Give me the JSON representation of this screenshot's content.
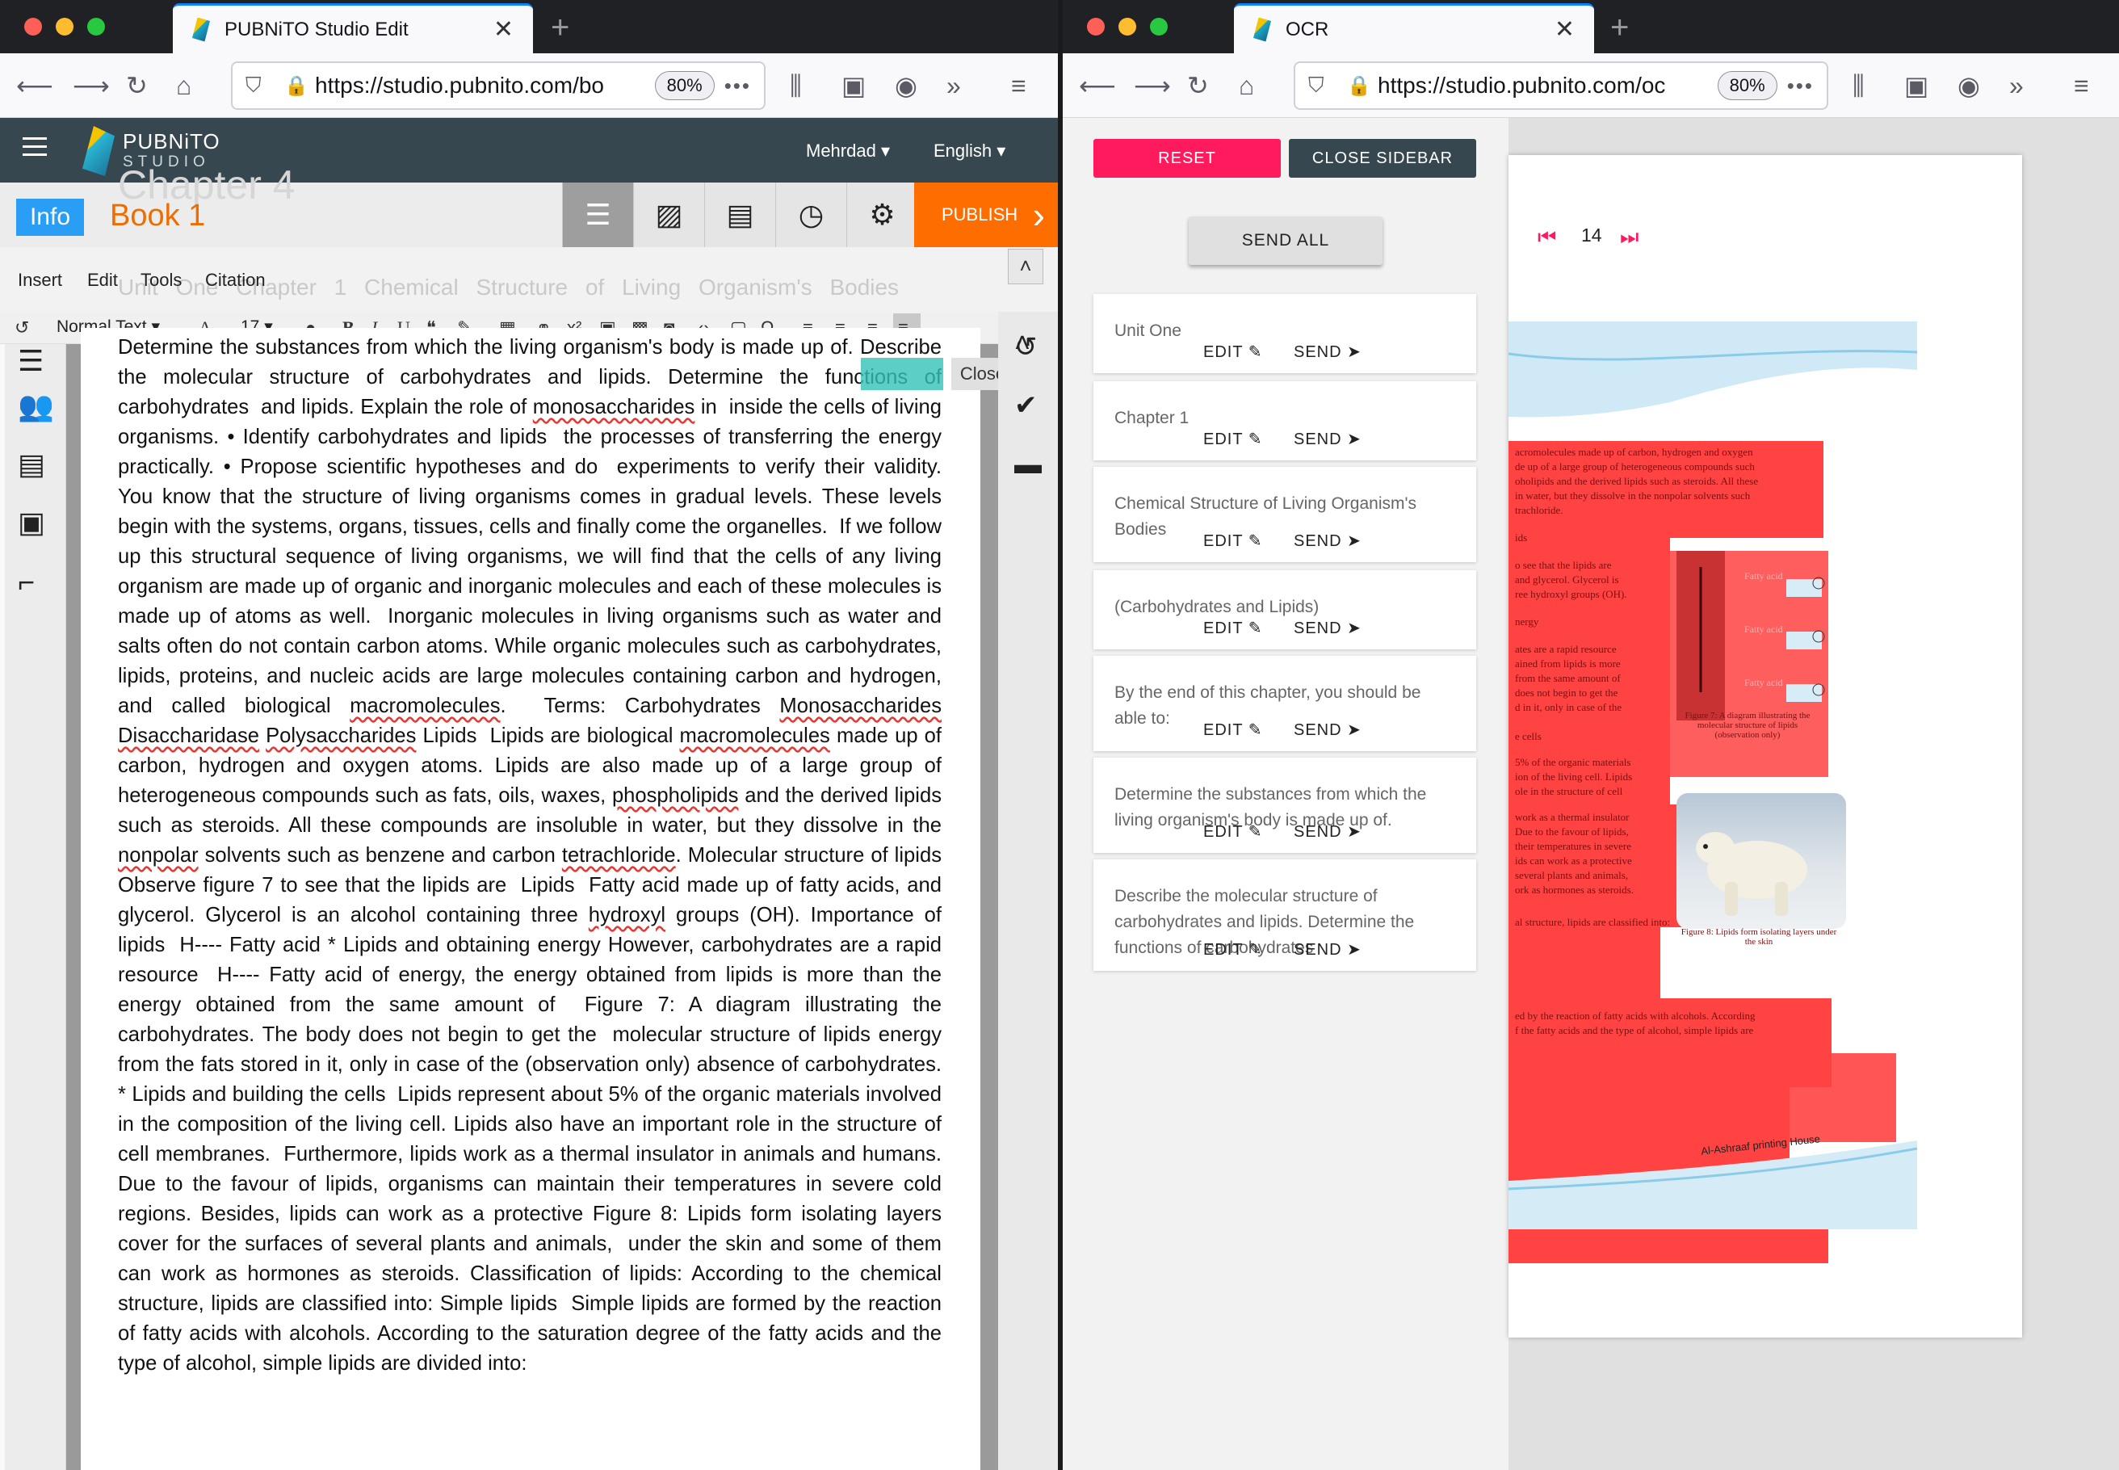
{
  "left_window": {
    "tab_title": "PUBNiTO Studio Edit",
    "url": "https://studio.pubnito.com/bo",
    "zoom": "80%",
    "app": {
      "brand": "PUBNiTO",
      "brand_sub": "STUDIO",
      "user": "Mehrdad",
      "language": "English",
      "info_label": "Info",
      "book_title": "Book 1",
      "ghost_heading": "Chapter 4",
      "publish_label": "PUBLISH",
      "menu": [
        "Insert",
        "Edit",
        "Tools",
        "Citation"
      ],
      "ghost_line": "Unit One Chapter 1 Chemical Structure of Living Organism's Bodies",
      "style_select": "Normal Text",
      "font_size": "17",
      "close_label": "Close",
      "icons": {
        "info": "list-icon",
        "images": "images-icon",
        "gallery": "gallery-icon",
        "history": "clock-icon",
        "settings": "gear-icon"
      }
    },
    "document_text": "Determine the substances from which the living organism's body is made up of. Describe the molecular structure of carbohydrates and lipids. Determine the functions of carbohydrates  and lipids. Explain the role of monosaccharides in  inside the cells of living organisms. • Identify carbohydrates and lipids  the processes of transferring the energy  practically. • Propose scientific hypotheses and do  experiments to verify their validity.  You know that the structure of living organisms comes in gradual levels. These levels begin with the systems, organs, tissues, cells and finally come the organelles.  If we follow up this structural sequence of living organisms, we will find that the cells of any living organism are made up of organic and inorganic molecules and each of these molecules is made up of atoms as well.  Inorganic molecules in living organisms such as water and salts often do not contain carbon atoms. While organic molecules such as carbohydrates, lipids, proteins, and nucleic acids are large molecules containing carbon and hydrogen, and called biological macromolecules.  Terms: Carbohydrates Monosaccharides Disaccharidase Polysaccharides Lipids  Lipids are biological macromolecules made up of carbon, hydrogen and oxygen atoms. Lipids are also made up of a large group of heterogeneous compounds such as fats, oils, waxes, phospholipids and the derived lipids such as steroids. All these compounds are insoluble in water, but they dissolve in the nonpolar solvents such as benzene and carbon tetrachloride. Molecular structure of lipids Observe figure 7 to see that the lipids are  Lipids  Fatty acid made up of fatty acids, and glycerol. Glycerol is an alcohol containing three hydroxyl groups (OH). Importance of lipids  H---- Fatty acid * Lipids and obtaining energy However, carbohydrates are a rapid resource  H---- Fatty acid of energy, the energy obtained from lipids is more than the energy obtained from the same amount of  Figure 7: A diagram illustrating the carbohydrates. The body does not begin to get the  molecular structure of lipids energy from the fats stored in it, only in case of the (observation only) absence of carbohydrates. * Lipids and building the cells  Lipids represent about 5% of the organic materials involved in the composition of the living cell. Lipids also have an important role in the structure of cell membranes.  Furthermore, lipids work as a thermal insulator in animals and humans. Due to the favour of lipids, organisms can maintain their temperatures in severe cold regions. Besides, lipids can work as a protective Figure 8: Lipids form isolating layers cover for the surfaces of several plants and animals,  under the skin and some of them can work as hormones as steroids. Classification of lipids: According to the chemical structure, lipids are classified into: Simple lipids  Simple lipids are formed by the reaction of fatty acids with alcohols. According to the saturation degree of the fatty acids and the type of alcohol, simple lipids are divided into:"
  },
  "right_window": {
    "tab_title": "OCR",
    "url": "https://studio.pubnito.com/oc",
    "zoom": "80%",
    "reset_label": "RESET",
    "close_sidebar_label": "CLOSE SIDEBAR",
    "send_all_label": "SEND ALL",
    "edit_label": "EDIT",
    "send_label": "SEND",
    "cards": [
      {
        "text": "Unit One"
      },
      {
        "text": "Chapter 1"
      },
      {
        "text": "Chemical Structure of Living Organism's Bodies"
      },
      {
        "text": "(Carbohydrates and Lipids)"
      },
      {
        "text": "By the end of this chapter, you should be able to:"
      },
      {
        "text": "Determine the substances from which the living organism's body is made up of."
      },
      {
        "text": "Describe the molecular structure of carbohydrates and lipids. Determine the functions of carbohydrates"
      }
    ],
    "page_number": "14",
    "page_lines": [
      "acromolecules made up of carbon, hydrogen and oxygen",
      "de up of a large group of heterogeneous compounds such",
      "oholipids and the derived lipids such as steroids. All these",
      "in water, but they dissolve in the nonpolar solvents such",
      "trachloride.",
      "ids",
      "o see that the lipids are",
      "and glycerol. Glycerol is",
      "ree hydroxyl groups (OH).",
      "nergy",
      "ates are a rapid resource",
      "ained from lipids is more",
      "from the same amount of",
      "does not begin to get the",
      "d in it, only in case of the",
      "e cells",
      "5% of the organic materials",
      "ion of the living cell. Lipids",
      "ole in the structure of cell",
      "work as a thermal insulator",
      "Due to the favour of lipids,",
      "their temperatures in severe",
      "ids can work as a protective",
      "several plants and animals,",
      "ork as hormones as steroids.",
      "al structure, lipids are classified into:",
      "ed by the reaction of fatty acids with alcohols. According",
      "f the fatty acids and the type of alcohol, simple lipids are"
    ],
    "fatty_acid_label": "Fatty acid",
    "fig7_caption": "Figure 7: A diagram illustrating the molecular structure of lipids (observation only)",
    "fig8_caption": "Figure 8: Lipids form isolating layers under the skin",
    "footer_text": "Al-Ashraaf printing House"
  }
}
